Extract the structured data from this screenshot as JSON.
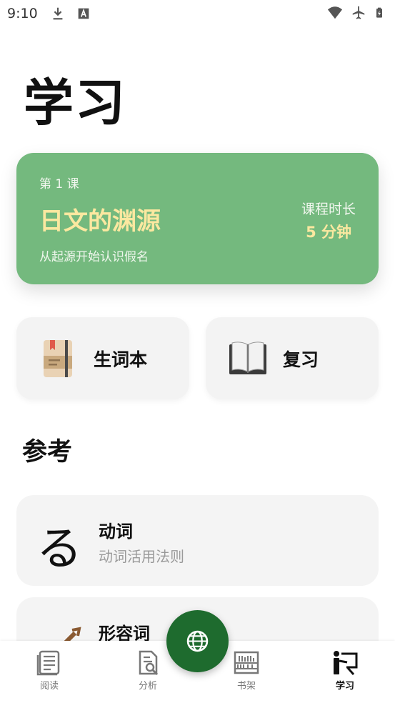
{
  "status_bar": {
    "time": "9:10",
    "left_icons": [
      "download-icon",
      "text-a-icon"
    ],
    "right_icons": [
      "wifi-icon",
      "airplane-mode-icon",
      "battery-charging-icon"
    ]
  },
  "page": {
    "title": "学习"
  },
  "lesson": {
    "number": "第 1 课",
    "title": "日文的渊源",
    "subtitle": "从起源开始认识假名",
    "duration_label": "课程时长",
    "duration_value": "5 分钟",
    "colors": {
      "card": "#74b97e",
      "accent_text": "#fbe8a0"
    }
  },
  "quick_actions": [
    {
      "label": "生词本",
      "icon": "notebook-icon"
    },
    {
      "label": "复习",
      "icon": "open-book-icon"
    }
  ],
  "reference": {
    "title": "参考",
    "items": [
      {
        "glyph": "る",
        "title": "动词",
        "description": "动词活用法则"
      },
      {
        "title": "形容词",
        "icon": "violin-icon"
      }
    ]
  },
  "bottom_nav": {
    "items": [
      {
        "label": "阅读",
        "icon": "reading-icon",
        "active": false
      },
      {
        "label": "分析",
        "icon": "analysis-icon",
        "active": false
      },
      {
        "label": "书架",
        "icon": "bookshelf-icon",
        "active": false
      },
      {
        "label": "学习",
        "icon": "study-icon",
        "active": true
      }
    ],
    "fab_icon": "globe-icon",
    "fab_color": "#1e6b2e"
  }
}
